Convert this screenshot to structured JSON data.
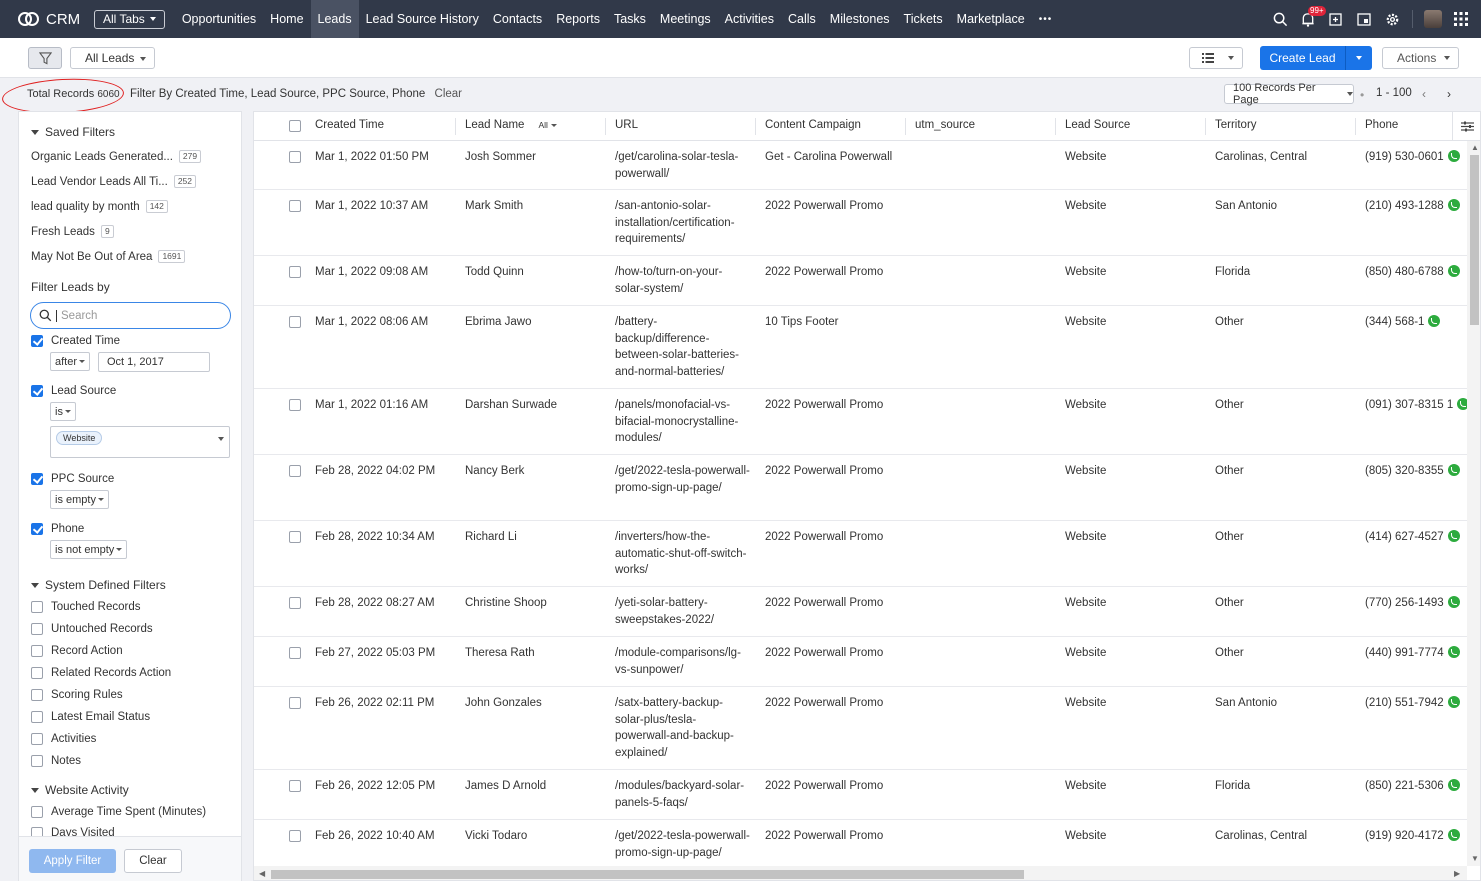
{
  "nav": {
    "brand": "CRM",
    "all_tabs": "All Tabs",
    "tabs": [
      "Opportunities",
      "Home",
      "Leads",
      "Lead Source History",
      "Contacts",
      "Reports",
      "Tasks",
      "Meetings",
      "Activities",
      "Calls",
      "Milestones",
      "Tickets",
      "Marketplace"
    ],
    "more": "•••",
    "notif_badge": "99+",
    "accent": "#313949"
  },
  "toolbar": {
    "view": "All Leads",
    "create_label": "Create Lead",
    "actions_label": "Actions",
    "primary_color": "#1a74e8"
  },
  "infobar": {
    "total_label": "Total Records",
    "total_value": "6060",
    "filter_label": "Filter By Created Time, Lead Source, PPC Source, Phone",
    "clear": "Clear",
    "per_page": "100 Records Per Page",
    "range": "1 - 100"
  },
  "sidebar": {
    "saved_filters_title": "Saved Filters",
    "saved_filters": [
      {
        "label": "Organic Leads Generated...",
        "count": "279"
      },
      {
        "label": "Lead Vendor Leads All Ti...",
        "count": "252"
      },
      {
        "label": "lead quality by month",
        "count": "142"
      },
      {
        "label": "Fresh Leads",
        "count": "9"
      },
      {
        "label": "May Not Be Out of Area",
        "count": "1691"
      }
    ],
    "filter_by_title": "Filter Leads by",
    "search_placeholder": "Search",
    "fields": {
      "created_time": {
        "label": "Created Time",
        "op": "after",
        "value": "Oct 1, 2017"
      },
      "lead_source": {
        "label": "Lead Source",
        "op": "is",
        "chip": "Website"
      },
      "ppc_source": {
        "label": "PPC Source",
        "op": "is empty"
      },
      "phone": {
        "label": "Phone",
        "op": "is not empty"
      }
    },
    "system_title": "System Defined Filters",
    "system_filters": [
      "Touched Records",
      "Untouched Records",
      "Record Action",
      "Related Records Action",
      "Scoring Rules",
      "Latest Email Status",
      "Activities",
      "Notes"
    ],
    "website_title": "Website Activity",
    "website_filters": [
      "Average Time Spent (Minutes)",
      "Days Visited"
    ],
    "apply": "Apply Filter",
    "clear": "Clear"
  },
  "table": {
    "columns": [
      "Created Time",
      "Lead Name",
      "URL",
      "Content Campaign",
      "utm_source",
      "Lead Source",
      "Territory",
      "Phone"
    ],
    "name_filter": "All",
    "rows": [
      {
        "time": "Mar 1, 2022 01:50 PM",
        "name": "Josh Sommer",
        "url": "/get/carolina-solar-tesla-powerwall/",
        "campaign": "Get - Carolina Powerwall",
        "utm": "",
        "source": "Website",
        "territory": "Carolinas, Central",
        "phone": "(919) 530-0601"
      },
      {
        "time": "Mar 1, 2022 10:37 AM",
        "name": "Mark Smith",
        "url": "/san-antonio-solar-installation/certification-requirements/",
        "campaign": "2022 Powerwall Promo",
        "utm": "",
        "source": "Website",
        "territory": "San Antonio",
        "phone": "(210) 493-1288"
      },
      {
        "time": "Mar 1, 2022 09:08 AM",
        "name": "Todd Quinn",
        "url": "/how-to/turn-on-your-solar-system/",
        "campaign": "2022 Powerwall Promo",
        "utm": "",
        "source": "Website",
        "territory": "Florida",
        "phone": "(850) 480-6788"
      },
      {
        "time": "Mar 1, 2022 08:06 AM",
        "name": "Ebrima Jawo",
        "url": "/battery-backup/difference-between-solar-batteries-and-normal-batteries/",
        "campaign": "10 Tips Footer",
        "utm": "",
        "source": "Website",
        "territory": "Other",
        "phone": "(344) 568-1"
      },
      {
        "time": "Mar 1, 2022 01:16 AM",
        "name": "Darshan Surwade",
        "url": "/panels/monofacial-vs-bifacial-monocrystalline-modules/",
        "campaign": "2022 Powerwall Promo",
        "utm": "",
        "source": "Website",
        "territory": "Other",
        "phone": "(091) 307-8315 1"
      },
      {
        "time": "Feb 28, 2022 04:02 PM",
        "name": "Nancy Berk",
        "url": "/get/2022-tesla-powerwall-promo-sign-up-page/",
        "campaign": "2022 Powerwall Promo",
        "utm": "",
        "source": "Website",
        "territory": "Other",
        "phone": "(805) 320-8355"
      },
      {
        "time": "Feb 28, 2022 10:34 AM",
        "name": "Richard Li",
        "url": "/inverters/how-the-automatic-shut-off-switch-works/",
        "campaign": "2022 Powerwall Promo",
        "utm": "",
        "source": "Website",
        "territory": "Other",
        "phone": "(414) 627-4527"
      },
      {
        "time": "Feb 28, 2022 08:27 AM",
        "name": "Christine Shoop",
        "url": "/yeti-solar-battery-sweepstakes-2022/",
        "campaign": "2022 Powerwall Promo",
        "utm": "",
        "source": "Website",
        "territory": "Other",
        "phone": "(770) 256-1493"
      },
      {
        "time": "Feb 27, 2022 05:03 PM",
        "name": "Theresa Rath",
        "url": "/module-comparisons/lg-vs-sunpower/",
        "campaign": "2022 Powerwall Promo",
        "utm": "",
        "source": "Website",
        "territory": "Other",
        "phone": "(440) 991-7774"
      },
      {
        "time": "Feb 26, 2022 02:11 PM",
        "name": "John Gonzales",
        "url": "/satx-battery-backup-solar-plus/tesla-powerwall-and-backup-explained/",
        "campaign": "2022 Powerwall Promo",
        "utm": "",
        "source": "Website",
        "territory": "San Antonio",
        "phone": "(210) 551-7942"
      },
      {
        "time": "Feb 26, 2022 12:05 PM",
        "name": "James D Arnold",
        "url": "/modules/backyard-solar-panels-5-faqs/",
        "campaign": "2022 Powerwall Promo",
        "utm": "",
        "source": "Website",
        "territory": "Florida",
        "phone": "(850) 221-5306"
      },
      {
        "time": "Feb 26, 2022 10:40 AM",
        "name": "Vicki Todaro",
        "url": "/get/2022-tesla-powerwall-promo-sign-up-page/",
        "campaign": "2022 Powerwall Promo",
        "utm": "",
        "source": "Website",
        "territory": "Carolinas, Central",
        "phone": "(919) 920-4172"
      }
    ]
  }
}
